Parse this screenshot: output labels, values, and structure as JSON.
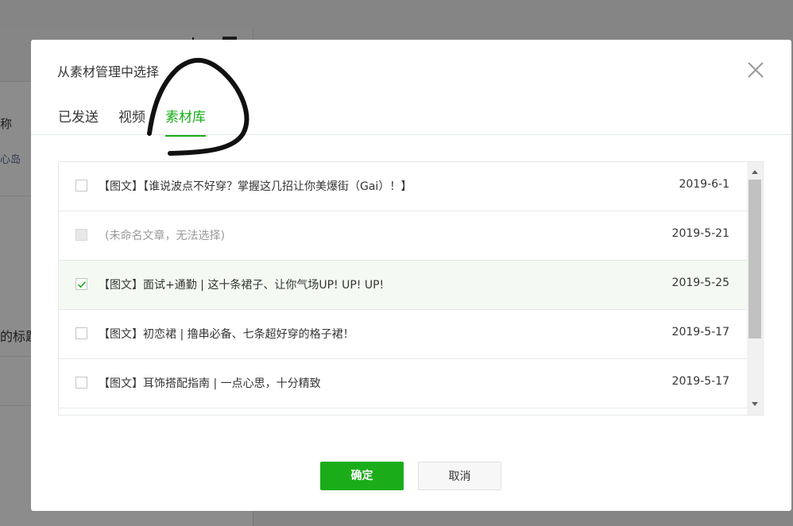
{
  "background": {
    "text_1": "称",
    "text_2": "心岛",
    "text_3": "的标题"
  },
  "dialog": {
    "title": "从素材管理中选择",
    "tabs": [
      {
        "label": "已发送",
        "active": false
      },
      {
        "label": "视频",
        "active": false
      },
      {
        "label": "素材库",
        "active": true
      }
    ],
    "items": [
      {
        "title": "【图文】【谁说波点不好穿？掌握这几招让你美爆街（Gai）！】",
        "date": "2019-6-1",
        "checked": false,
        "disabled": false
      },
      {
        "title": "(未命名文章，无法选择)",
        "date": "2019-5-21",
        "checked": false,
        "disabled": true
      },
      {
        "title": "【图文】面试+通勤 | 这十条裙子、让你气场UP! UP! UP!",
        "date": "2019-5-25",
        "checked": true,
        "disabled": false
      },
      {
        "title": "【图文】初恋裙 | 撸串必备、七条超好穿的格子裙！",
        "date": "2019-5-17",
        "checked": false,
        "disabled": false
      },
      {
        "title": "【图文】耳饰搭配指南 | 一点心思，十分精致",
        "date": "2019-5-17",
        "checked": false,
        "disabled": false
      }
    ],
    "confirm_label": "确定",
    "cancel_label": "取消"
  },
  "colors": {
    "accent": "#1aad19",
    "selected_row": "#f4faf2"
  },
  "icons": {
    "close": "close-icon",
    "check": "checkmark-icon",
    "scroll_up": "scroll-up-arrow-icon",
    "scroll_down": "scroll-down-arrow-icon"
  }
}
